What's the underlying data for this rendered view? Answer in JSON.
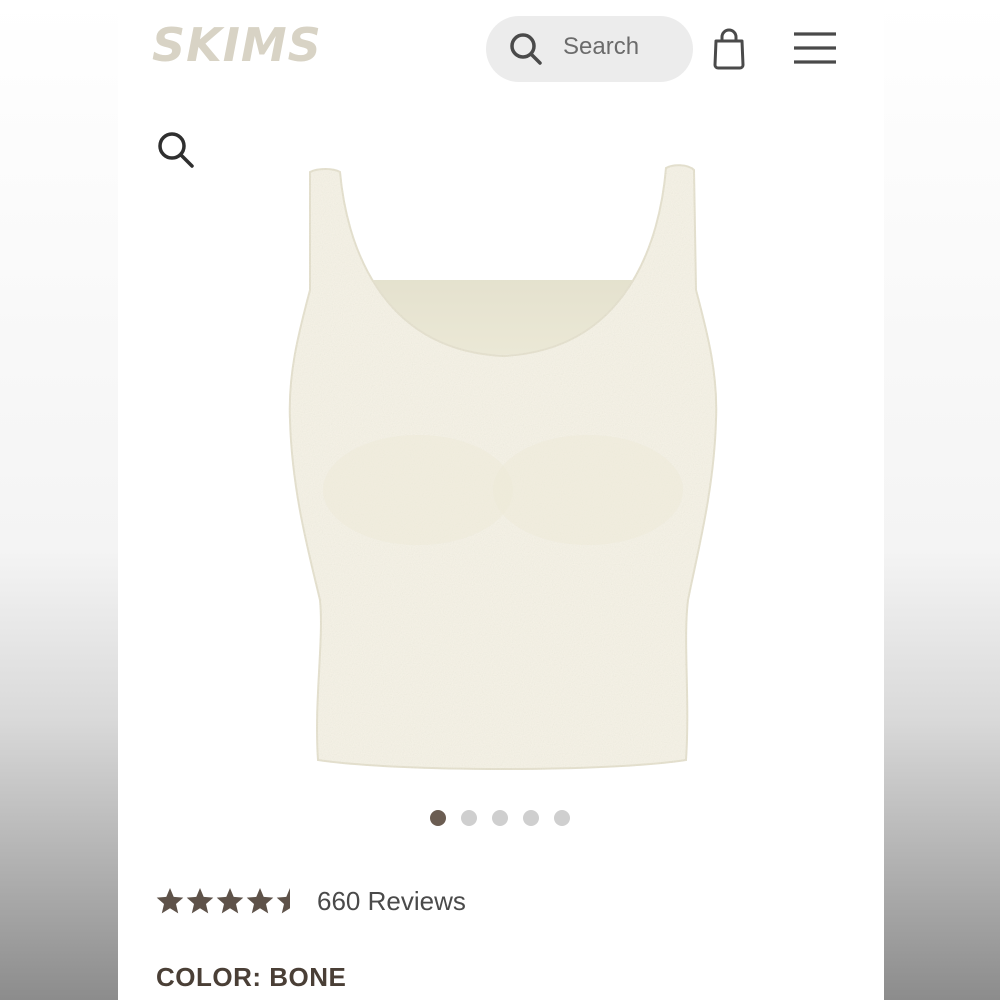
{
  "header": {
    "logo_text": "SKIMS",
    "search_label": "Search",
    "icons": {
      "search": "search-icon",
      "bag": "shopping-bag-icon",
      "menu": "hamburger-menu-icon"
    }
  },
  "product": {
    "zoom_icon": "search-icon",
    "image_alt": "cream textured tank top",
    "carousel": {
      "count": 5,
      "active_index": 0
    },
    "rating": {
      "value": 4.5,
      "max": 5,
      "reviews_text": "660 Reviews"
    },
    "color_label": "COLOR: BONE"
  },
  "colors": {
    "logo": "#d8d3c5",
    "text_brown": "#4a3f36",
    "star": "#5e5249",
    "dot_active": "#6b5d52",
    "dot_inactive": "#cfcfcf",
    "pill_bg": "#ececec",
    "garment": "#f6f3e6"
  }
}
